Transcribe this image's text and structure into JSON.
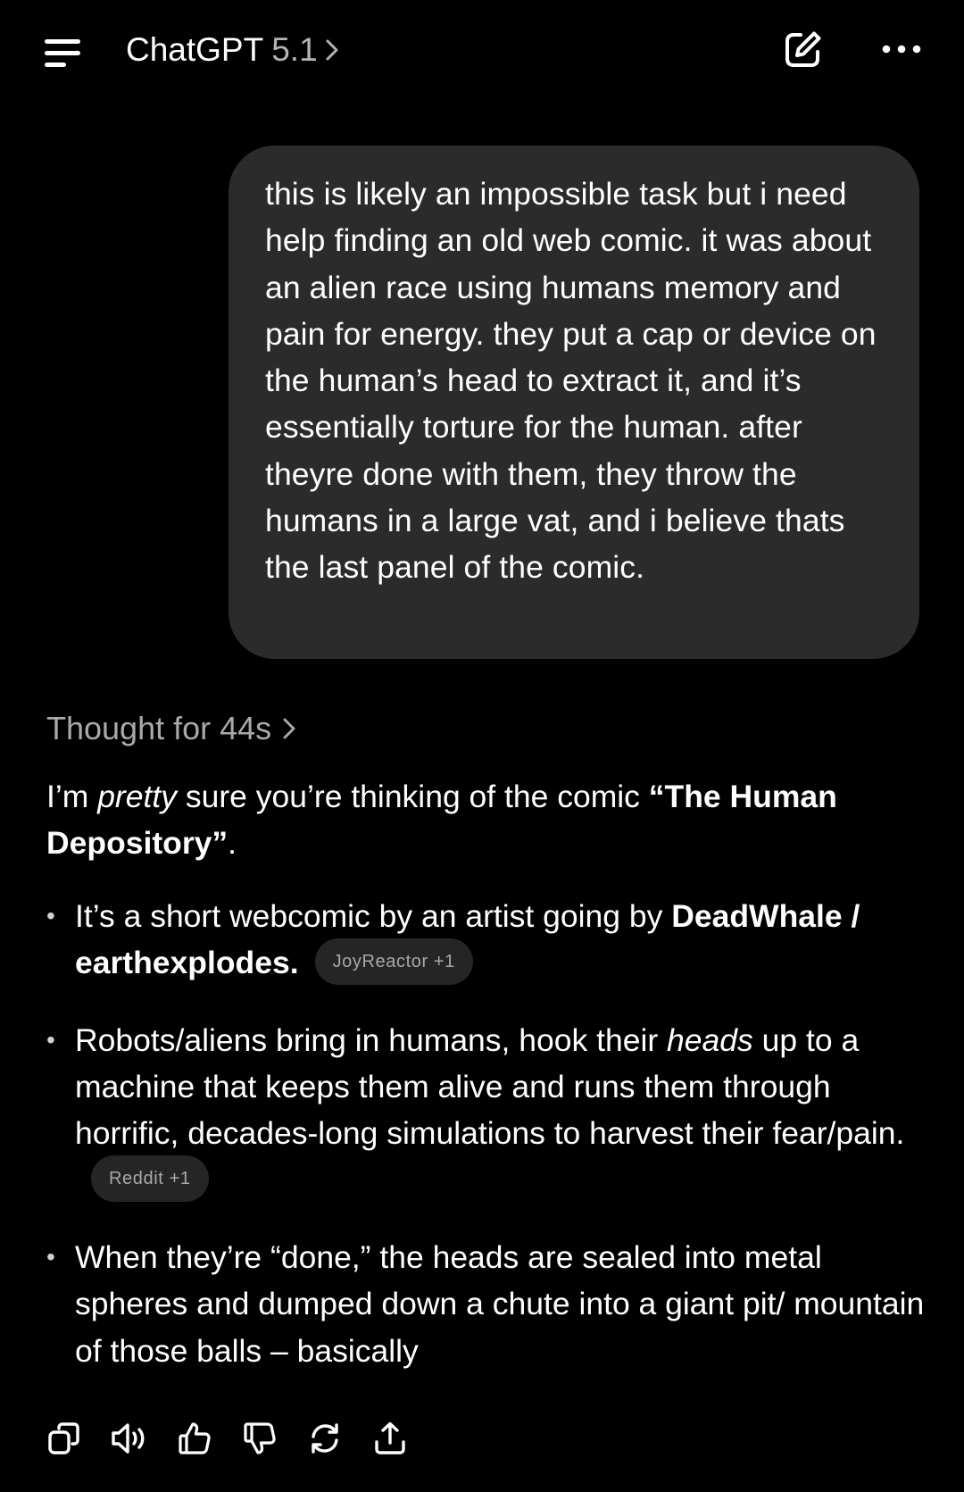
{
  "header": {
    "title": "ChatGPT",
    "version": "5.1",
    "icons": [
      "menu-icon",
      "chevron-right-icon",
      "new-chat-icon",
      "more-icon"
    ]
  },
  "user_message": {
    "text": "this is likely an impossible task but i need help finding an old web comic. it was about an alien race using humans memory and pain for energy. they put a cap or device on the human’s head to extract it, and it’s essentially torture for the human. after theyre done with them, they throw the humans in a large vat, and i believe thats the last panel of the comic."
  },
  "thought": {
    "label": "Thought for 44s"
  },
  "response": {
    "intro": {
      "pre": "I’m ",
      "em": "pretty",
      "mid": " sure you’re thinking of the comic ",
      "strong": "“The Human Depository”",
      "post": "."
    },
    "bullets": [
      {
        "pre": "It’s a short webcomic by an artist going by ",
        "strong": "DeadWhale / earthexplodes.",
        "chip": "JoyReactor +1"
      },
      {
        "pre": "Robots/aliens bring in humans, hook their ",
        "em": "heads",
        "post": " up to a machine that keeps them alive and runs them through horrific, decades-long simulations to harvest their fear/pain.",
        "chip": "Reddit +1"
      },
      {
        "text": "When they’re “done,” the heads are sealed into metal spheres and dumped down a chute into a giant pit/ mountain of those balls – basically"
      }
    ]
  },
  "actions": [
    "copy-icon",
    "read-aloud-icon",
    "thumbs-up-icon",
    "thumbs-down-icon",
    "regenerate-icon",
    "share-icon"
  ],
  "colors": {
    "background": "#000000",
    "bubble": "#2b2b2b",
    "muted_text": "#a9a9a9",
    "chip_bg": "#252525"
  }
}
